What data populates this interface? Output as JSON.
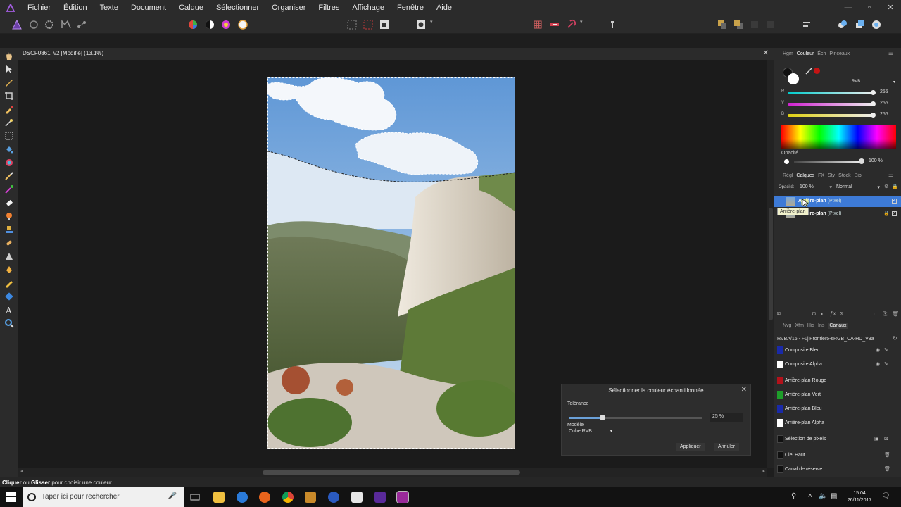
{
  "app": {
    "menu": [
      "Fichier",
      "Édition",
      "Texte",
      "Document",
      "Calque",
      "Sélectionner",
      "Organiser",
      "Filtres",
      "Affichage",
      "Fenêtre",
      "Aide"
    ],
    "window_controls": [
      "—",
      "▫",
      "✕"
    ]
  },
  "document": {
    "tab_title": "DSCF0861_v2 [Modifié] (13.1%)",
    "close": "✕"
  },
  "color_panel": {
    "tabs": [
      "Hgm",
      "Couleur",
      "Éch",
      "Pinceaux"
    ],
    "active_tab": "Couleur",
    "model": "RVB",
    "sliders": [
      {
        "label": "R",
        "value": "255"
      },
      {
        "label": "V",
        "value": "255"
      },
      {
        "label": "B",
        "value": "255"
      }
    ],
    "opacity_label": "Opacité",
    "opacity_value": "100 %"
  },
  "layers_panel": {
    "tabs": [
      "Régl",
      "Calques",
      "FX",
      "Sty",
      "Stock",
      "Bib"
    ],
    "active_tab": "Calques",
    "opacity_label": "Opacité:",
    "opacity_value": "100 %",
    "blend_mode": "Normal",
    "layers": [
      {
        "name": "Arrière-plan",
        "type": "(Pixel)",
        "selected": true
      },
      {
        "name": "Arrière-plan",
        "type": "(Pixel)",
        "selected": false
      }
    ],
    "tooltip": "Arrière-plan"
  },
  "channels_panel": {
    "tabs": [
      "Nvg",
      "Xfm",
      "His",
      "Ins",
      "Canaux"
    ],
    "active_tab": "Canaux",
    "profile": "RVBA/16 - FujiFrontier5-sRGB_CA-HD_V3a",
    "channels": [
      {
        "name": "Composite Bleu",
        "color": "#1a2aa8"
      },
      {
        "name": "Composite Alpha",
        "color": "#ffffff"
      },
      {
        "name": "Arrière-plan Rouge",
        "color": "#b3121b"
      },
      {
        "name": "Arrière-plan Vert",
        "color": "#1e9e2a"
      },
      {
        "name": "Arrière-plan Bleu",
        "color": "#1a2aa8"
      },
      {
        "name": "Arrière-plan Alpha",
        "color": "#ffffff"
      },
      {
        "name": "Sélection de pixels",
        "color": "#111111"
      },
      {
        "name": "Ciel Haut",
        "color": "#111111"
      },
      {
        "name": "Canal de réserve",
        "color": "#111111"
      }
    ]
  },
  "dialog": {
    "title": "Sélectionner la couleur échantillonnée",
    "tolerance_label": "Tolérance",
    "tolerance_value": "25 %",
    "tolerance_fraction": 0.25,
    "model_label": "Modèle",
    "model_value": "Cube RVB",
    "apply": "Appliquer",
    "cancel": "Annuler"
  },
  "status": {
    "action1": "Cliquer",
    "sep": "ou",
    "action2": "Glisser",
    "rest": "pour choisir une couleur."
  },
  "taskbar": {
    "search_placeholder": "Taper ici pour rechercher",
    "time": "15:04",
    "date": "26/11/2017"
  }
}
